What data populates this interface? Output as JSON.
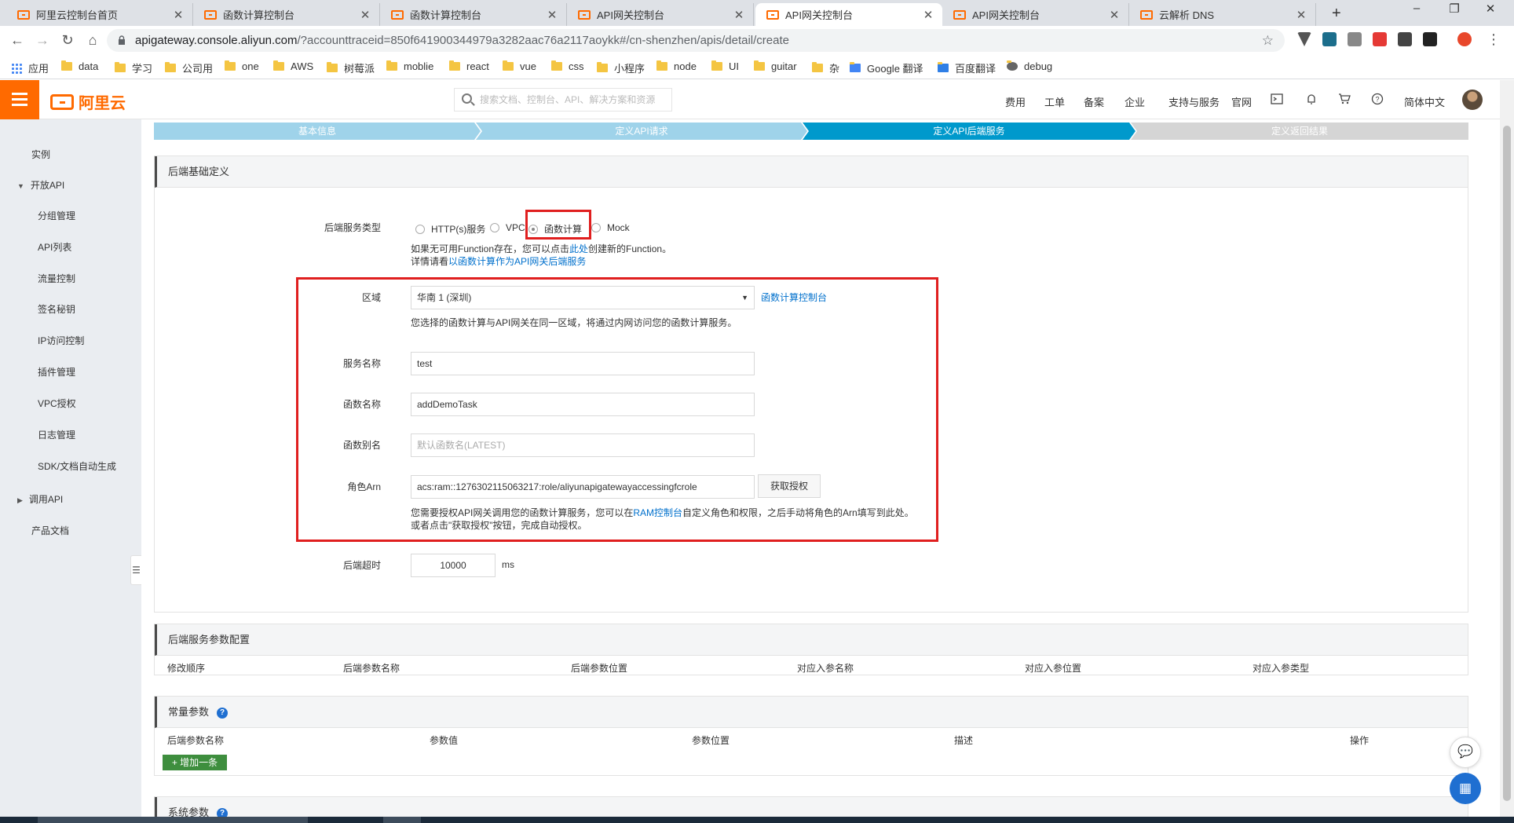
{
  "browser": {
    "tabs": [
      {
        "label": "阿里云控制台首页",
        "active": false
      },
      {
        "label": "函数计算控制台",
        "active": false
      },
      {
        "label": "函数计算控制台",
        "active": false
      },
      {
        "label": "API网关控制台",
        "active": false
      },
      {
        "label": "API网关控制台",
        "active": true
      },
      {
        "label": "API网关控制台",
        "active": false
      },
      {
        "label": "云解析 DNS",
        "active": false
      }
    ],
    "url_host": "apigateway.console.aliyun.com",
    "url_path": "/?accounttraceid=850f641900344979a3282aac76a2117aoykk#/cn-shenzhen/apis/detail/create",
    "bookmarks": [
      "应用",
      "data",
      "学习",
      "公司用",
      "one",
      "AWS",
      "树莓派",
      "moblie",
      "react",
      "vue",
      "css",
      "小程序",
      "node",
      "UI",
      "guitar",
      "杂",
      "Google 翻译",
      "百度翻译",
      "debug"
    ]
  },
  "console": {
    "logo_text": "阿里云",
    "search_placeholder": "搜索文档、控制台、API、解决方案和资源",
    "nav_links": [
      "费用",
      "工单",
      "备案",
      "企业",
      "支持与服务",
      "官网"
    ],
    "language": "简体中文"
  },
  "sidebar": {
    "items": [
      "实例",
      "开放API",
      "分组管理",
      "API列表",
      "流量控制",
      "签名秘钥",
      "IP访问控制",
      "插件管理",
      "VPC授权",
      "日志管理",
      "SDK/文档自动生成",
      "调用API",
      "产品文档"
    ]
  },
  "steps": [
    "基本信息",
    "定义API请求",
    "定义API后端服务",
    "定义返回结果"
  ],
  "backend": {
    "title": "后端基础定义",
    "service_type_label": "后端服务类型",
    "service_types": [
      "HTTP(s)服务",
      "VPC",
      "函数计算",
      "Mock"
    ],
    "selected_type": "函数计算",
    "hint_line1_pre": "如果无可用Function存在，您可以点击",
    "hint_line1_link": "此处",
    "hint_line1_post": "创建新的Function。",
    "hint_line2_pre": "详情请看",
    "hint_line2_link": "以函数计算作为API网关后端服务",
    "region_label": "区域",
    "region_value": "华南 1 (深圳)",
    "region_link": "函数计算控制台",
    "region_hint": "您选择的函数计算与API网关在同一区域，将通过内网访问您的函数计算服务。",
    "service_name_label": "服务名称",
    "service_name_value": "test",
    "function_name_label": "函数名称",
    "function_name_value": "addDemoTask",
    "alias_label": "函数别名",
    "alias_placeholder": "默认函数名(LATEST)",
    "role_label": "角色Arn",
    "role_value": "acs:ram::1276302115063217:role/aliyunapigatewayaccessingfcrole",
    "get_auth_button": "获取授权",
    "role_hint1_pre": "您需要授权API网关调用您的函数计算服务，您可以在",
    "role_hint1_link": "RAM控制台",
    "role_hint1_post": "自定义角色和权限，之后手动将角色的Arn填写到此处。",
    "role_hint2": "或者点击\"获取授权\"按钮，完成自动授权。",
    "timeout_label": "后端超时",
    "timeout_value": "10000",
    "timeout_unit": "ms"
  },
  "param_config": {
    "title": "后端服务参数配置",
    "columns": [
      "修改顺序",
      "后端参数名称",
      "后端参数位置",
      "对应入参名称",
      "对应入参位置",
      "对应入参类型"
    ]
  },
  "const_params": {
    "title": "常量参数",
    "columns": [
      "后端参数名称",
      "参数值",
      "参数位置",
      "描述",
      "操作"
    ],
    "add_button": "增加一条"
  },
  "system_params": {
    "title": "系统参数"
  },
  "colors": {
    "accent": "#ff6a00",
    "step_done": "#9fd3ea",
    "step_active": "#0099cc",
    "step_pending": "#d5d5d5",
    "highlight": "#e01f1f",
    "link": "#0070cc"
  }
}
